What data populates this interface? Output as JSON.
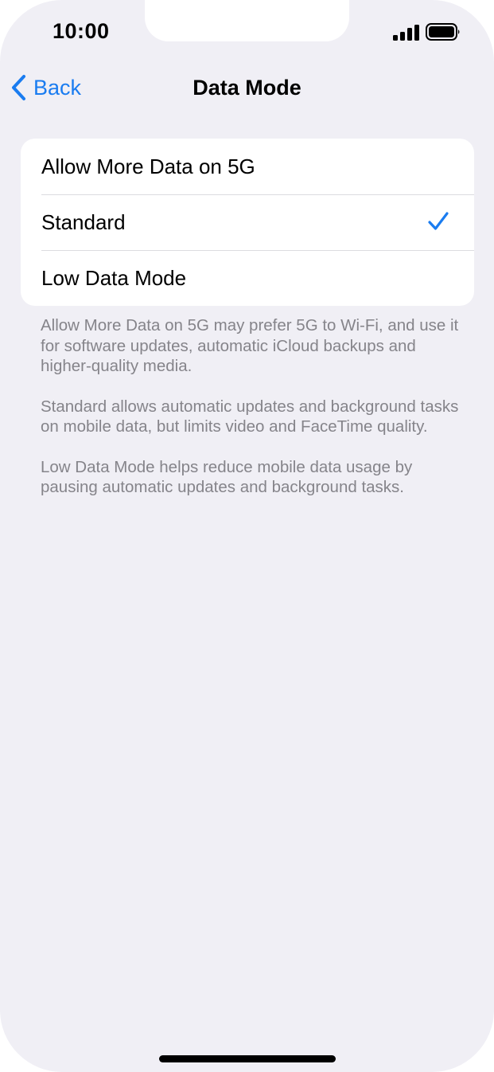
{
  "status_bar": {
    "time": "10:00",
    "signal_icon": "cellular-signal-icon",
    "battery_icon": "battery-full-icon"
  },
  "nav": {
    "back_icon": "chevron-left-icon",
    "back_label": "Back",
    "title": "Data Mode"
  },
  "options": [
    {
      "label": "Allow More Data on 5G",
      "selected": false
    },
    {
      "label": "Standard",
      "selected": true
    },
    {
      "label": "Low Data Mode",
      "selected": false
    }
  ],
  "notes": [
    "Allow More Data on 5G may prefer 5G to Wi-Fi, and use it for software updates, automatic iCloud backups and higher-quality media.",
    "Standard allows automatic updates and background tasks on mobile data, but limits video and FaceTime quality.",
    "Low Data Mode helps reduce mobile data usage by pausing automatic updates and background tasks."
  ],
  "colors": {
    "accent": "#1a7cf0",
    "background": "#f0eff5",
    "secondary_text": "#85848a"
  }
}
